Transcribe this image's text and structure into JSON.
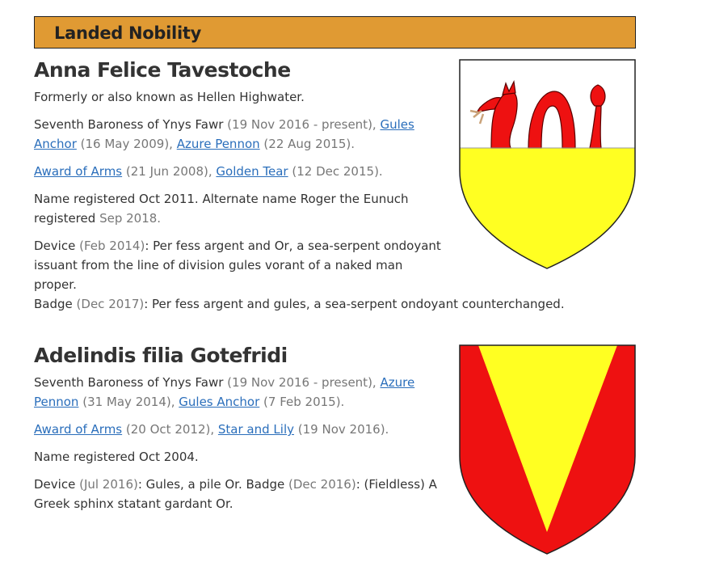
{
  "section": {
    "title": "Landed Nobility"
  },
  "people": [
    {
      "name": "Anna Felice Tavestoche",
      "aka": "Formerly or also known as Hellen Highwater.",
      "title_line": {
        "title": "Seventh Baroness of Ynys Fawr",
        "title_date": "(19 Nov 2016 - present),",
        "award1": "Gules Anchor",
        "award1_date": "(16 May 2009),",
        "award2": "Azure Pennon",
        "award2_date": "(22 Aug 2015)."
      },
      "arms_line": {
        "award1": "Award of Arms",
        "award1_date": "(21 Jun 2008),",
        "award2": "Golden Tear",
        "award2_date": "(12 Dec 2015)."
      },
      "name_reg": {
        "text1": "Name registered Oct 2011. Alternate name Roger the Eunuch registered",
        "date": "Sep 2018."
      },
      "device": {
        "label": "Device",
        "date": "(Feb 2014)",
        "text": ": Per fess argent and Or, a sea-serpent ondoyant issuant from the line of division gules vorant of a naked man proper."
      },
      "badge": {
        "label": "Badge",
        "date": "(Dec 2017)",
        "text": ": Per fess argent and gules, a sea-serpent ondoyant counterchanged."
      }
    },
    {
      "name": "Adelindis filia Gotefridi",
      "title_line": {
        "title": "Seventh Baroness of Ynys Fawr",
        "title_date": "(19 Nov 2016 - present),",
        "award1": "Azure Pennon",
        "award1_date": "(31 May 2014),",
        "award2": "Gules Anchor",
        "award2_date": "(7 Feb 2015)."
      },
      "arms_line": {
        "award1": "Award of Arms",
        "award1_date": "(20 Oct 2012),",
        "award2": "Star and Lily",
        "award2_date": "(19 Nov 2016)."
      },
      "name_reg": {
        "text1": "Name registered Oct 2004."
      },
      "device": {
        "label": "Device",
        "date": "(Jul 2016)",
        "text1": ": Gules, a pile Or. Badge",
        "badge_date": "(Dec 2016)",
        "text2": ": (Fieldless) A Greek sphinx statant gardant Or."
      }
    }
  ],
  "colors": {
    "header_bg": "#E09A33",
    "link": "#2A6EBB",
    "gules": "#EE1111",
    "or": "#FFFF22",
    "argent": "#FFFFFF"
  },
  "icons": {
    "shield1": "sea-serpent-device-icon",
    "shield2": "pile-device-icon"
  }
}
